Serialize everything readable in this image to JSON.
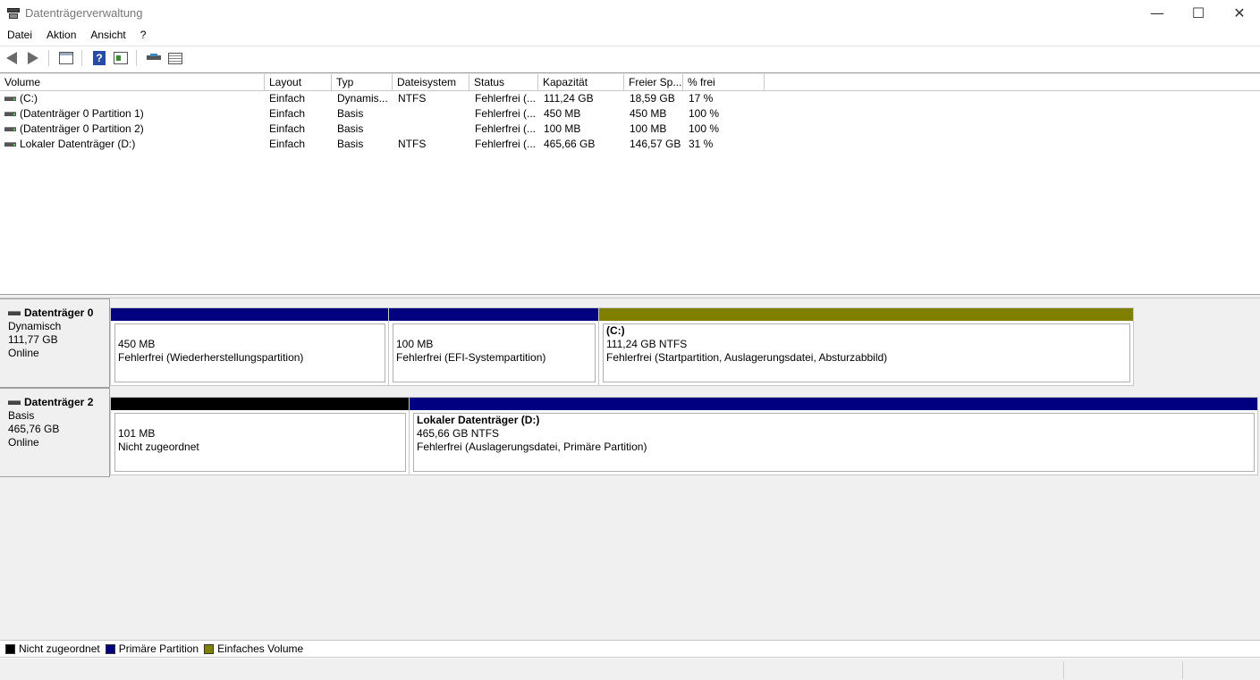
{
  "window": {
    "title": "Datenträgerverwaltung",
    "controls": {
      "minimize": "—",
      "maximize": "☐",
      "close": "✕"
    }
  },
  "menu": [
    "Datei",
    "Aktion",
    "Ansicht",
    "?"
  ],
  "toolbar": {
    "icons": [
      "back-arrow-icon",
      "forward-arrow-icon",
      "console-tree-icon",
      "help-icon",
      "properties-icon",
      "disk-icon",
      "list-icon"
    ]
  },
  "volumes": {
    "columns": [
      "Volume",
      "Layout",
      "Typ",
      "Dateisystem",
      "Status",
      "Kapazität",
      "Freier Sp...",
      "% frei"
    ],
    "rows": [
      {
        "volume": " (C:)",
        "layout": "Einfach",
        "typ": "Dynamis...",
        "fs": "NTFS",
        "status": "Fehlerfrei (...",
        "cap": "111,24 GB",
        "free": "18,59 GB",
        "pct": "17 %"
      },
      {
        "volume": "(Datenträger 0 Partition 1)",
        "layout": "Einfach",
        "typ": "Basis",
        "fs": "",
        "status": "Fehlerfrei (...",
        "cap": "450 MB",
        "free": "450 MB",
        "pct": "100 %"
      },
      {
        "volume": "(Datenträger 0 Partition 2)",
        "layout": "Einfach",
        "typ": "Basis",
        "fs": "",
        "status": "Fehlerfrei (...",
        "cap": "100 MB",
        "free": "100 MB",
        "pct": "100 %"
      },
      {
        "volume": "Lokaler Datenträger (D:)",
        "layout": "Einfach",
        "typ": "Basis",
        "fs": "NTFS",
        "status": "Fehlerfrei (...",
        "cap": "465,66 GB",
        "free": "146,57 GB",
        "pct": "31 %"
      }
    ]
  },
  "disks": [
    {
      "name": "Datenträger 0",
      "type": "Dynamisch",
      "size": "111,77 GB",
      "state": "Online",
      "partitions": [
        {
          "title": "",
          "line1": "450 MB",
          "line2": "Fehlerfrei (Wiederherstellungspartition)",
          "color": "#000080"
        },
        {
          "title": "",
          "line1": "100 MB",
          "line2": "Fehlerfrei (EFI-Systempartition)",
          "color": "#000080"
        },
        {
          "title": " (C:)",
          "line1": "111,24 GB NTFS",
          "line2": "Fehlerfrei (Startpartition, Auslagerungsdatei, Absturzabbild)",
          "color": "#808000"
        }
      ]
    },
    {
      "name": "Datenträger 2",
      "type": "Basis",
      "size": "465,76 GB",
      "state": "Online",
      "partitions": [
        {
          "title": "",
          "line1": "101 MB",
          "line2": "Nicht zugeordnet",
          "color": "#000000"
        },
        {
          "title": "Lokaler Datenträger  (D:)",
          "line1": "465,66 GB NTFS",
          "line2": "Fehlerfrei (Auslagerungsdatei, Primäre Partition)",
          "color": "#000080"
        }
      ]
    }
  ],
  "legend": [
    {
      "label": "Nicht zugeordnet",
      "color": "#000000"
    },
    {
      "label": "Primäre Partition",
      "color": "#000080"
    },
    {
      "label": "Einfaches Volume",
      "color": "#808000"
    }
  ]
}
